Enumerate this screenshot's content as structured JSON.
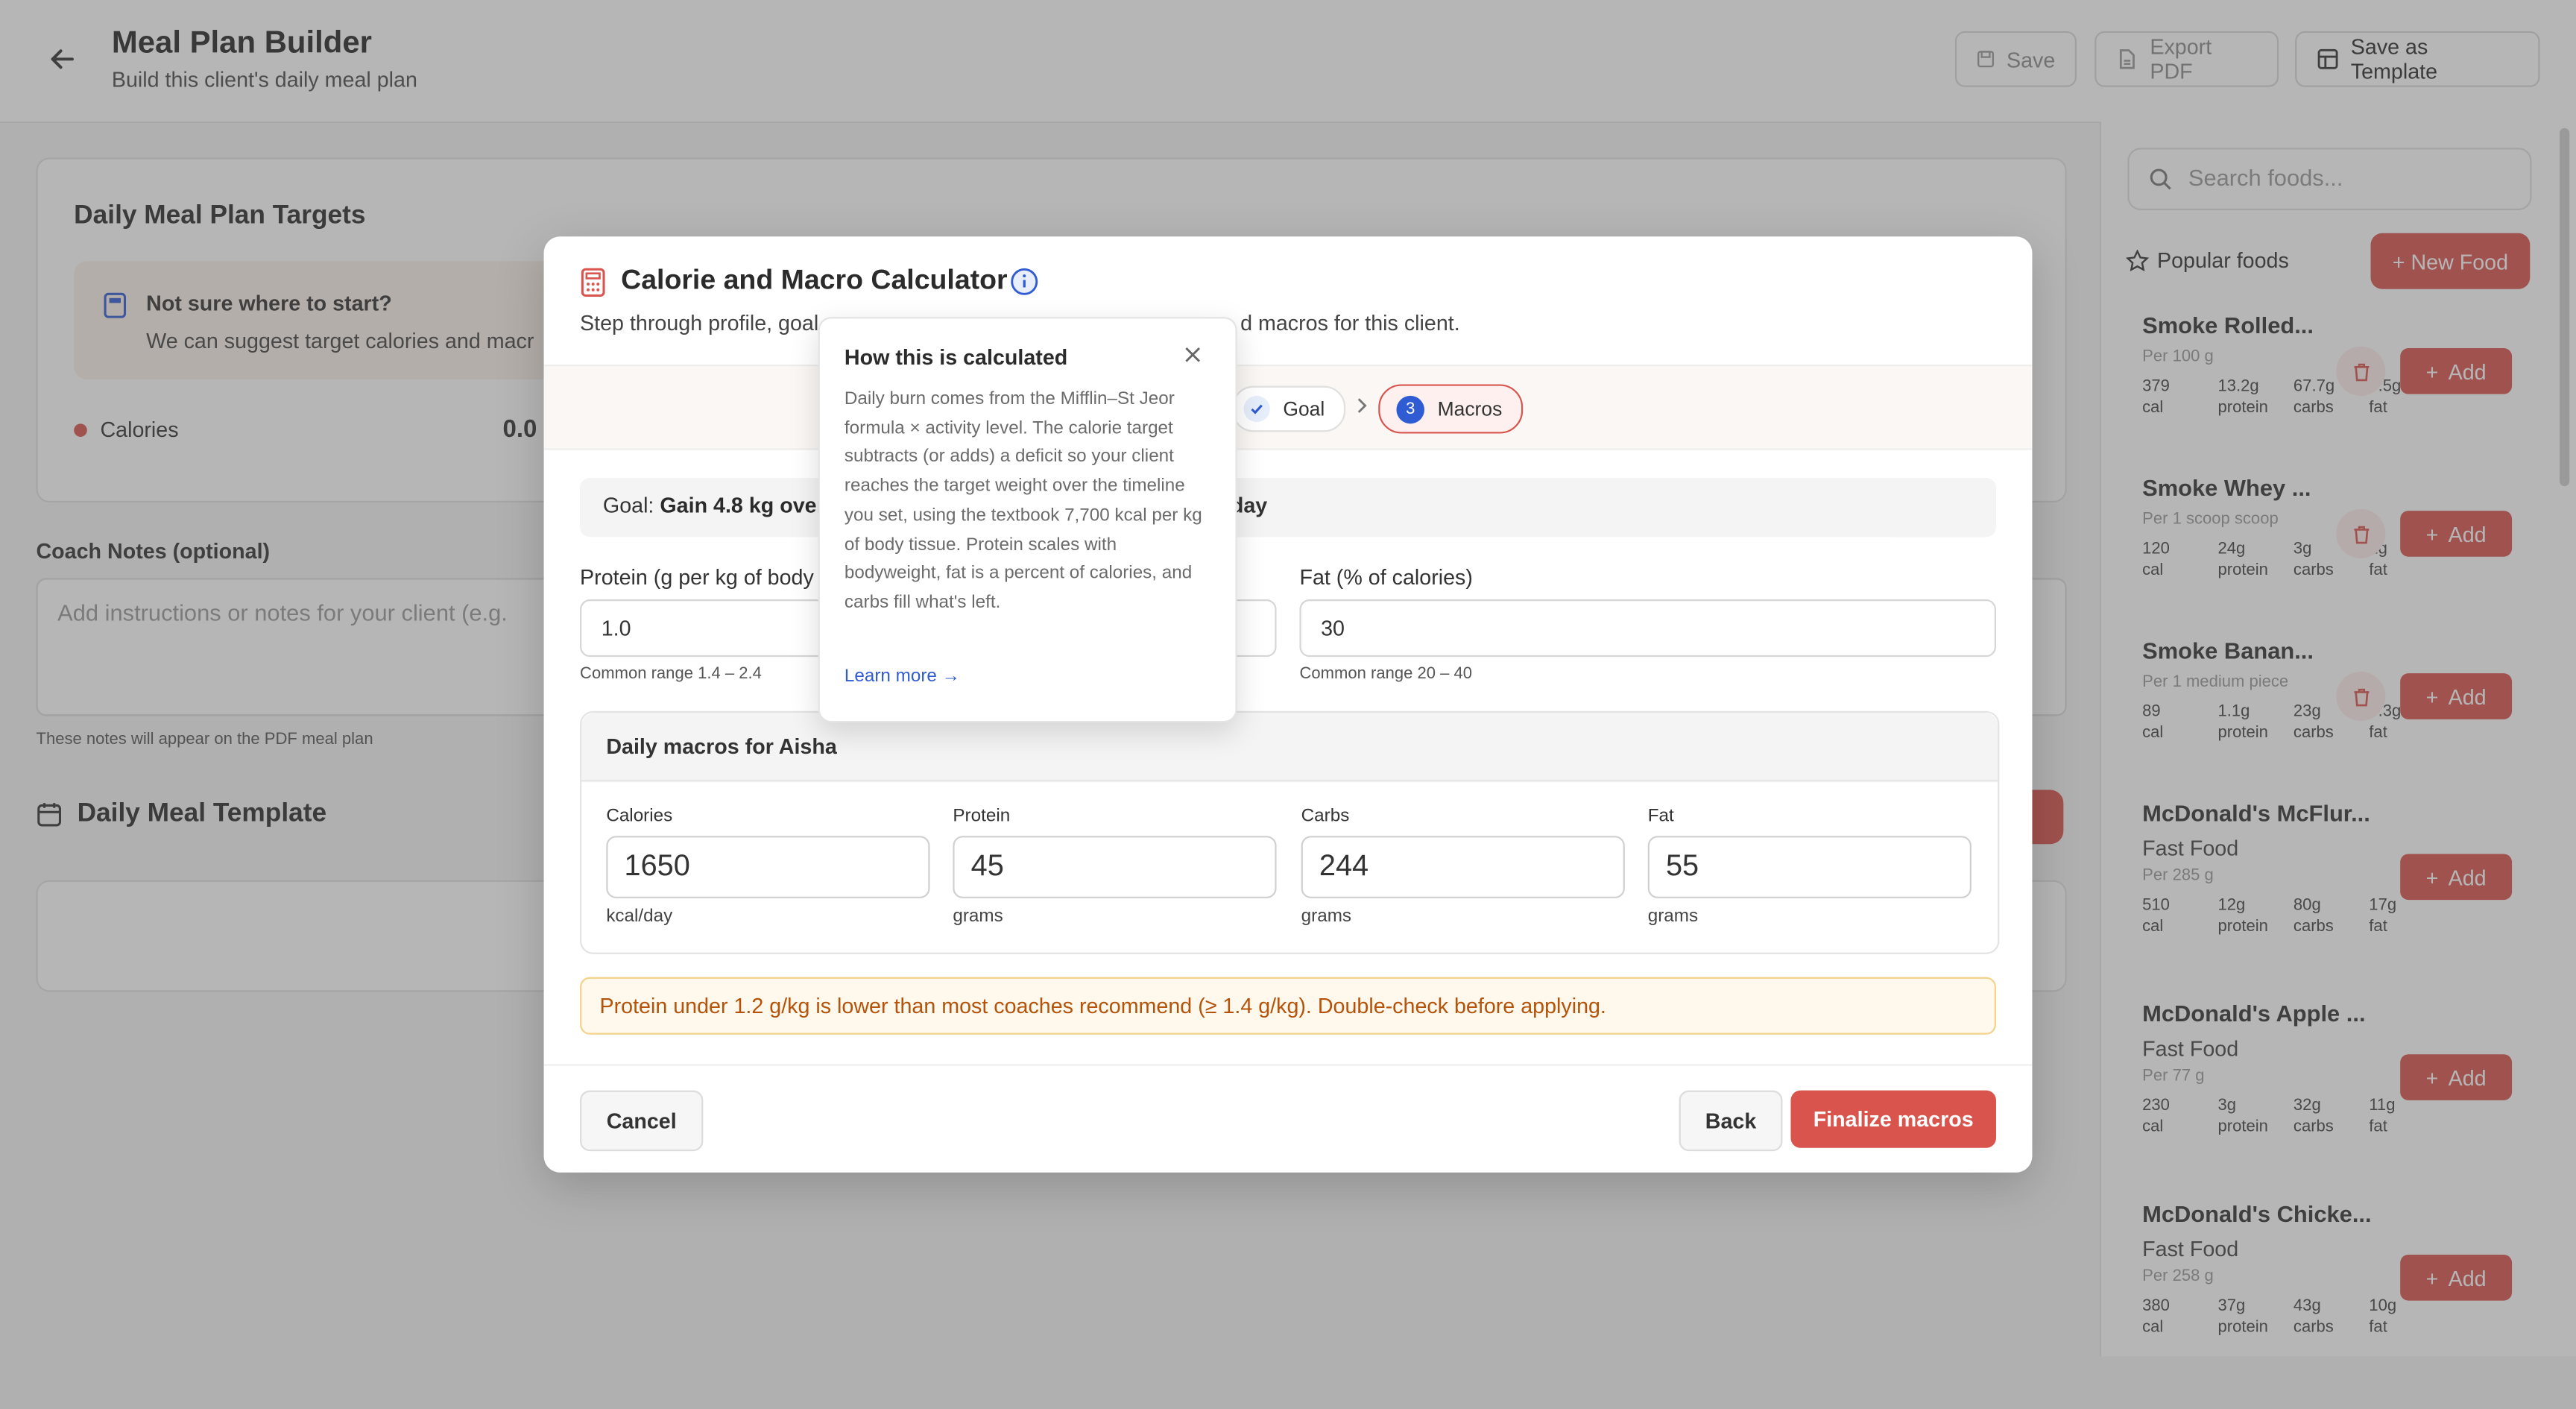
{
  "header": {
    "title": "Meal Plan Builder",
    "subtitle": "Build this client's daily meal plan",
    "save_label": "Save",
    "export_label": "Export PDF",
    "template_label": "Save as Template"
  },
  "targets": {
    "title": "Daily Meal Plan Targets",
    "hint_title": "Not sure where to start?",
    "hint_text": "We can suggest target calories and macr",
    "calories_label": "Calories",
    "calories_value": "0.0"
  },
  "notes": {
    "label": "Coach Notes (optional)",
    "placeholder": "Add instructions or notes for your client (e.g.",
    "help": "These notes will appear on the PDF meal plan"
  },
  "template": {
    "title": "Daily Meal Template"
  },
  "sidebar": {
    "search_placeholder": "Search foods...",
    "popular_label": "Popular foods",
    "new_food_label": "+ New Food",
    "add_label": "Add",
    "foods": [
      {
        "name": "Smoke Rolled...",
        "category": "",
        "serving": "Per 100 g",
        "cal": "379",
        "protein": "13.2g",
        "carbs": "67.7g",
        "fat": "6.5g"
      },
      {
        "name": "Smoke Whey ...",
        "category": "",
        "serving": "Per 1 scoop scoop",
        "cal": "120",
        "protein": "24g",
        "carbs": "3g",
        "fat": "1g"
      },
      {
        "name": "Smoke Banan...",
        "category": "",
        "serving": "Per 1 medium piece",
        "cal": "89",
        "protein": "1.1g",
        "carbs": "23g",
        "fat": "0.3g"
      },
      {
        "name": "McDonald's McFlur...",
        "category": "Fast Food",
        "serving": "Per 285 g",
        "cal": "510",
        "protein": "12g",
        "carbs": "80g",
        "fat": "17g"
      },
      {
        "name": "McDonald's Apple ...",
        "category": "Fast Food",
        "serving": "Per 77 g",
        "cal": "230",
        "protein": "3g",
        "carbs": "32g",
        "fat": "11g"
      },
      {
        "name": "McDonald's Chicke...",
        "category": "Fast Food",
        "serving": "Per 258 g",
        "cal": "380",
        "protein": "37g",
        "carbs": "43g",
        "fat": "10g"
      }
    ],
    "unit_labels": {
      "cal": "cal",
      "protein": "protein",
      "carbs": "carbs",
      "fat": "fat"
    }
  },
  "modal": {
    "title": "Calorie and Macro Calculator",
    "subtitle_start": "Step through profile, goal",
    "subtitle_end": "d macros for this client.",
    "step_goal": "Goal",
    "step_macros_num": "3",
    "step_macros": "Macros",
    "goal_prefix": "Goal:",
    "goal_value": "Gain 4.8 kg over",
    "goal_tail": "day",
    "protein_label": "Protein (g per kg of body",
    "protein_value": "1.0",
    "protein_help": "Common range 1.4 – 2.4",
    "fat_label": "Fat (% of calories)",
    "fat_value": "30",
    "fat_help": "Common range 20 – 40",
    "daily_title": "Daily macros for Aisha",
    "daily": [
      {
        "label": "Calories",
        "value": "1650",
        "unit": "kcal/day"
      },
      {
        "label": "Protein",
        "value": "45",
        "unit": "grams"
      },
      {
        "label": "Carbs",
        "value": "244",
        "unit": "grams"
      },
      {
        "label": "Fat",
        "value": "55",
        "unit": "grams"
      }
    ],
    "warning": "Protein under 1.2 g/kg is lower than most coaches recommend (≥ 1.4 g/kg). Double-check before applying.",
    "cancel_label": "Cancel",
    "back_label": "Back",
    "finalize_label": "Finalize macros"
  },
  "tooltip": {
    "title": "How this is calculated",
    "body": "Daily burn comes from the Mifflin–St Jeor formula × activity level. The calorie target subtracts (or adds) a deficit so your client reaches the target weight over the timeline you set, using the textbook 7,700 kcal per kg of body tissue. Protein scales with bodyweight, fat is a percent of calories, and carbs fill what's left.",
    "link": "Learn more →"
  },
  "colors": {
    "accent": "#d9544d",
    "link": "#2f5bd3",
    "warning_text": "#b45309"
  }
}
